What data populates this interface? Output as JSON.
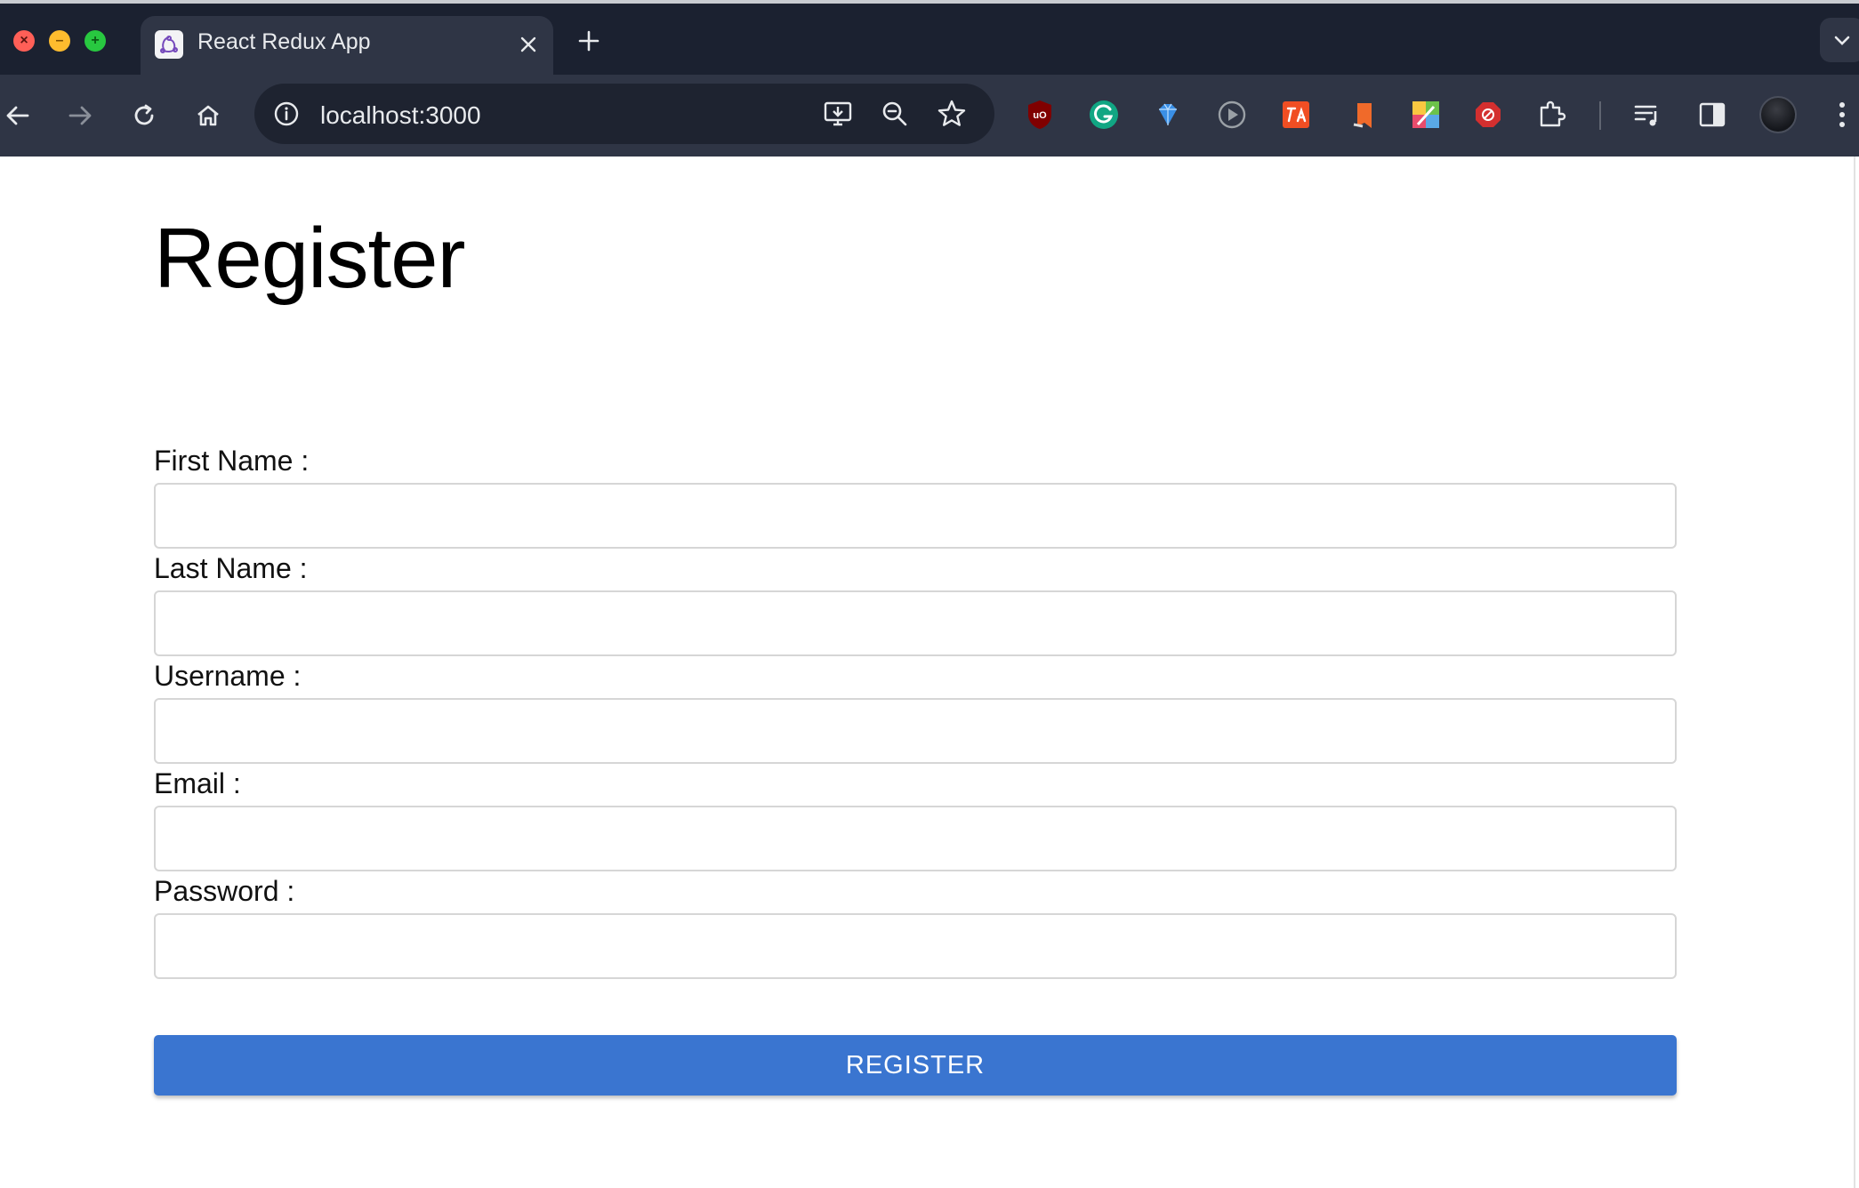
{
  "browser": {
    "tab": {
      "title": "React Redux App"
    },
    "address_bar": {
      "url": "localhost:3000"
    },
    "traffic_lights": {
      "close": "×",
      "minimize": "–",
      "maximize": "+"
    }
  },
  "page": {
    "title": "Register",
    "fields": [
      {
        "label": "First Name :",
        "value": "",
        "placeholder": ""
      },
      {
        "label": "Last Name :",
        "value": "",
        "placeholder": ""
      },
      {
        "label": "Username :",
        "value": "",
        "placeholder": ""
      },
      {
        "label": "Email :",
        "value": "",
        "placeholder": ""
      },
      {
        "label": "Password :",
        "value": "",
        "placeholder": ""
      }
    ],
    "submit_label": "REGISTER"
  },
  "colors": {
    "chrome_dark": "#1b2130",
    "toolbar": "#2f3545",
    "button_blue": "#3a75d0"
  },
  "icons": {
    "extensions": [
      "ublock-icon",
      "grammarly-icon",
      "diamond-icon",
      "play-icon",
      "translate-icon",
      "flag-icon",
      "color-picker-icon",
      "adblock-icon",
      "puzzle-icon"
    ],
    "toolbar_right": [
      "reading-list-icon",
      "side-panel-icon",
      "avatar",
      "menu-dots-icon"
    ]
  }
}
